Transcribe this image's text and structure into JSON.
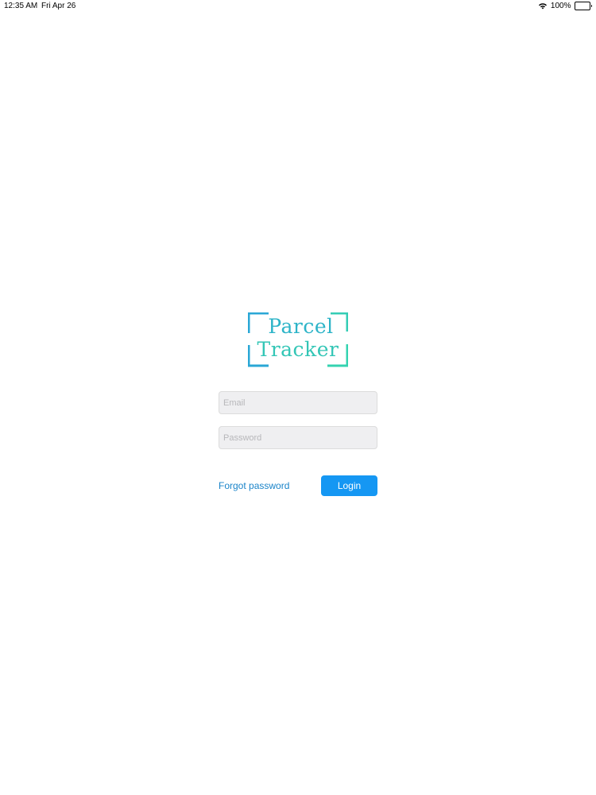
{
  "status_bar": {
    "time": "12:35 AM",
    "date": "Fri Apr 26",
    "battery": "100%",
    "battery_level": 1.0
  },
  "logo": {
    "line1": "Parcel",
    "line2": "Tracker",
    "colors": {
      "bracket_left": "#2aa7d6",
      "bracket_right": "#34d3b0",
      "text_top": "#2db4c8",
      "text_bottom": "#33c6b6"
    }
  },
  "login_form": {
    "email": {
      "placeholder": "Email",
      "value": ""
    },
    "password": {
      "placeholder": "Password",
      "value": ""
    },
    "forgot_password_label": "Forgot password",
    "login_label": "Login"
  },
  "colors": {
    "accent": "#1597f3",
    "link": "#1a84c9",
    "field_background": "#efeff1"
  }
}
